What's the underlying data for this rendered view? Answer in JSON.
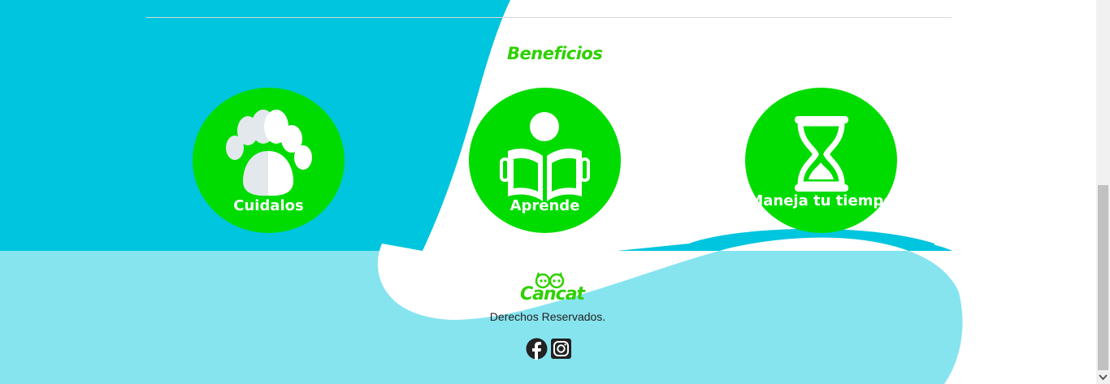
{
  "section": {
    "title": "Beneficios"
  },
  "benefits": [
    {
      "label": "Cuidalos",
      "icon": "paw-icon"
    },
    {
      "label": "Aprende",
      "icon": "reader-icon"
    },
    {
      "label": "Maneja tu tiempo",
      "icon": "hourglass-icon"
    }
  ],
  "footer": {
    "logo_text": "Cancat",
    "rights": "Derechos Reservados.",
    "social": [
      {
        "name": "facebook",
        "icon": "facebook-icon"
      },
      {
        "name": "instagram",
        "icon": "instagram-icon"
      }
    ]
  },
  "colors": {
    "accent_green": "#00dc00",
    "title_green": "#2fd000",
    "cyan": "#00c5de",
    "light_cyan": "#86e4ef",
    "white": "#ffffff"
  }
}
